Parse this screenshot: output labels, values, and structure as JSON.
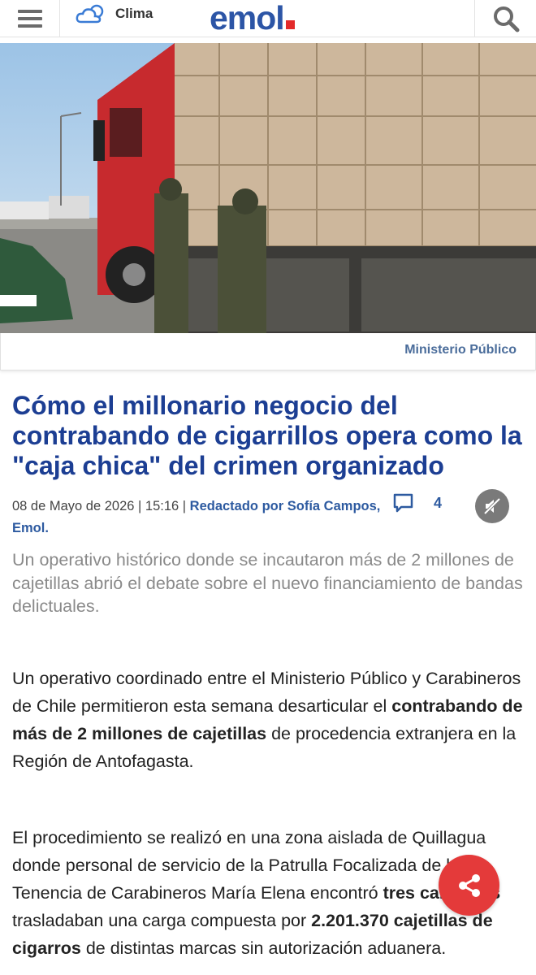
{
  "header": {
    "clima_label": "Clima",
    "logo_text": "emol"
  },
  "hero": {
    "image_description_icon": "truck-contraband-photo",
    "caption": "Ministerio Público"
  },
  "article": {
    "title": "Cómo el millonario negocio del contrabando de cigarrillos opera como la \"caja chica\" del crimen organizado",
    "date": "08 de Mayo de 2026 | 15:16 | ",
    "author": "Redactado por Sofía Campos, Emol.",
    "comment_count": "4",
    "summary": "Un operativo histórico donde se incautaron más de 2 millones de cajetillas abrió el debate sobre el nuevo financiamiento de bandas delictuales.",
    "p1": {
      "a": "Un operativo coordinado entre el Ministerio Público y Carabineros de Chile permitieron esta semana desarticular el ",
      "b": "contrabando de más de 2 millones de cajetillas",
      "c": " de procedencia extranjera en la Región de Antofagasta."
    },
    "p2": {
      "a": "El procedimiento se realizó en una zona aislada de Quillagua donde personal de servicio de la Patrulla Focalizada de la Tenencia de Carabineros María Elena encontró ",
      "b": "tres camiones",
      "c": " trasladaban una carga compuesta por ",
      "d": "2.201.370 cajetillas de cigarros",
      "e": " de distintas marcas sin autorización aduanera."
    }
  },
  "colors": {
    "brand_blue": "#2c55a6",
    "title_blue": "#1c3e93",
    "share_red": "#e43a3a"
  }
}
